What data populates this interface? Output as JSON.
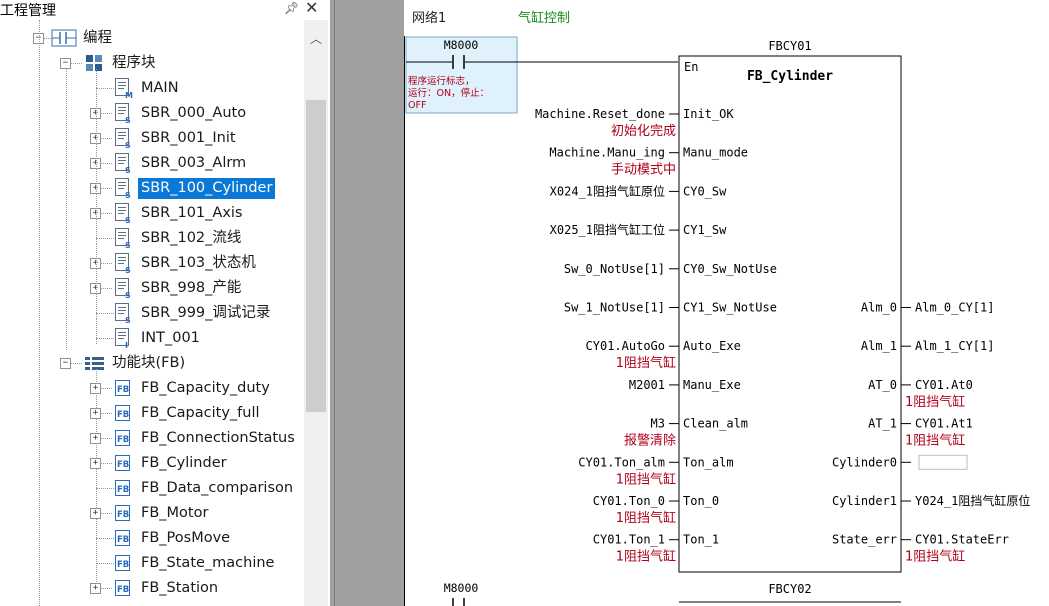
{
  "project_panel": {
    "title": "工程管理",
    "pin_icon": "pin-icon",
    "close_icon": "close-icon",
    "tree": {
      "programming": "编程",
      "program_blocks": "程序块",
      "items": [
        {
          "label": "MAIN",
          "icon": "main-program-icon",
          "expand": false
        },
        {
          "label": "SBR_000_Auto",
          "icon": "subroutine-icon",
          "expand": true
        },
        {
          "label": "SBR_001_Init",
          "icon": "subroutine-icon",
          "expand": true
        },
        {
          "label": "SBR_003_Alrm",
          "icon": "subroutine-icon",
          "expand": true
        },
        {
          "label": "SBR_100_Cylinder",
          "icon": "subroutine-icon",
          "expand": true,
          "selected": true
        },
        {
          "label": "SBR_101_Axis",
          "icon": "subroutine-icon",
          "expand": true
        },
        {
          "label": "SBR_102_流线",
          "icon": "subroutine-icon",
          "expand": false
        },
        {
          "label": "SBR_103_状态机",
          "icon": "subroutine-icon",
          "expand": true
        },
        {
          "label": "SBR_998_产能",
          "icon": "subroutine-icon",
          "expand": true
        },
        {
          "label": "SBR_999_调试记录",
          "icon": "subroutine-debug-icon",
          "expand": false
        },
        {
          "label": "INT_001",
          "icon": "interrupt-icon",
          "expand": false
        }
      ],
      "function_blocks": "功能块(FB)",
      "fb_items": [
        {
          "label": "FB_Capacity_duty",
          "expand": true
        },
        {
          "label": "FB_Capacity_full",
          "expand": true
        },
        {
          "label": "FB_ConnectionStatus",
          "expand": true
        },
        {
          "label": "FB_Cylinder",
          "expand": true
        },
        {
          "label": "FB_Data_comparison",
          "expand": false
        },
        {
          "label": "FB_Motor",
          "expand": true
        },
        {
          "label": "FB_PosMove",
          "expand": false
        },
        {
          "label": "FB_State_machine",
          "expand": false
        },
        {
          "label": "FB_Station",
          "expand": true
        }
      ]
    }
  },
  "ladder": {
    "network_label": "网络1",
    "network_comment": "气缸控制",
    "contact": {
      "name": "M8000",
      "comment": "程序运行标志，运行：ON，停止：OFF"
    },
    "fb_instance": "FBCY01",
    "fb_type": "FB_Cylinder",
    "en_pin": "En",
    "inputs": [
      {
        "var": "Machine.Reset_done",
        "pin": "Init_OK",
        "comment": "初始化完成"
      },
      {
        "var": "Machine.Manu_ing",
        "pin": "Manu_mode",
        "comment": "手动模式中"
      },
      {
        "var": "X024_1阻挡气缸原位",
        "pin": "CY0_Sw",
        "comment": ""
      },
      {
        "var": "X025_1阻挡气缸工位",
        "pin": "CY1_Sw",
        "comment": ""
      },
      {
        "var": "Sw_0_NotUse[1]",
        "pin": "CY0_Sw_NotUse",
        "comment": ""
      },
      {
        "var": "Sw_1_NotUse[1]",
        "pin": "CY1_Sw_NotUse",
        "comment": ""
      },
      {
        "var": "CY01.AutoGo",
        "pin": "Auto_Exe",
        "comment": "1阻挡气缸"
      },
      {
        "var": "M2001",
        "pin": "Manu_Exe",
        "comment": ""
      },
      {
        "var": "M3",
        "pin": "Clean_alm",
        "comment": "报警清除"
      },
      {
        "var": "CY01.Ton_alm",
        "pin": "Ton_alm",
        "comment": "1阻挡气缸"
      },
      {
        "var": "CY01.Ton_0",
        "pin": "Ton_0",
        "comment": "1阻挡气缸"
      },
      {
        "var": "CY01.Ton_1",
        "pin": "Ton_1",
        "comment": "1阻挡气缸"
      }
    ],
    "outputs": [
      {
        "pin": "Alm_0",
        "var": "Alm_0_CY[1]",
        "comment": ""
      },
      {
        "pin": "Alm_1",
        "var": "Alm_1_CY[1]",
        "comment": ""
      },
      {
        "pin": "AT_0",
        "var": "CY01.At0",
        "comment": "1阻挡气缸"
      },
      {
        "pin": "AT_1",
        "var": "CY01.At1",
        "comment": "1阻挡气缸"
      },
      {
        "pin": "Cylinder0",
        "var": "",
        "comment": ""
      },
      {
        "pin": "Cylinder1",
        "var": "Y024_1阻挡气缸原位",
        "comment": ""
      },
      {
        "pin": "State_err",
        "var": "CY01.StateErr",
        "comment": "1阻挡气缸"
      }
    ],
    "next_contact": "M8000",
    "next_fb_instance": "FBCY02"
  },
  "colors": {
    "selection": "#0a78d7",
    "comment_red": "#b0001a",
    "network_comment_green": "#1a8a1a",
    "contact_highlight": "#dff1fb"
  }
}
